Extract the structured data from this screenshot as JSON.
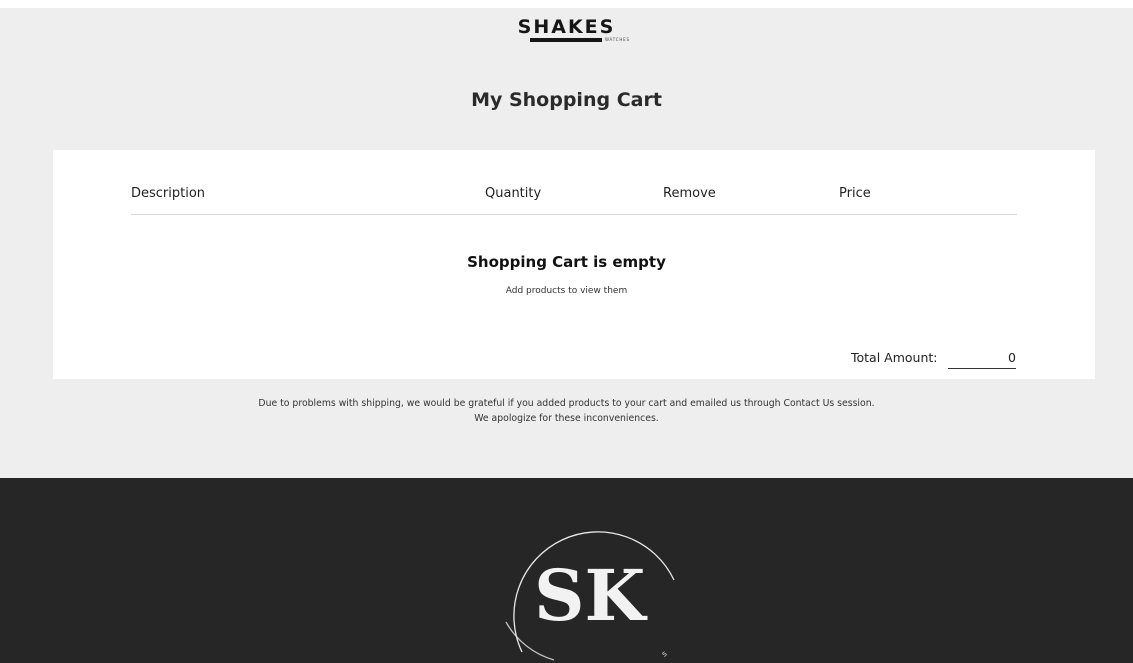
{
  "header": {
    "logo_text": "SHAKES",
    "logo_subtext": "WATCHES"
  },
  "page": {
    "title": "My Shopping Cart"
  },
  "cart": {
    "columns": [
      "Description",
      "Quantity",
      "Remove",
      "Price"
    ],
    "empty_title": "Shopping Cart is empty",
    "empty_subtitle": "Add products to view them",
    "total_label": "Total Amount:",
    "total_value": "0"
  },
  "notice": {
    "line1": "Due to problems with shipping, we would be grateful if you added products to your cart and emailed us through Contact Us session.",
    "line2": "We apologize for these inconveniences."
  },
  "footer": {
    "logo_monogram": "SK",
    "logo_icon": "sk-monogram-logo",
    "background_color": "#262626"
  }
}
